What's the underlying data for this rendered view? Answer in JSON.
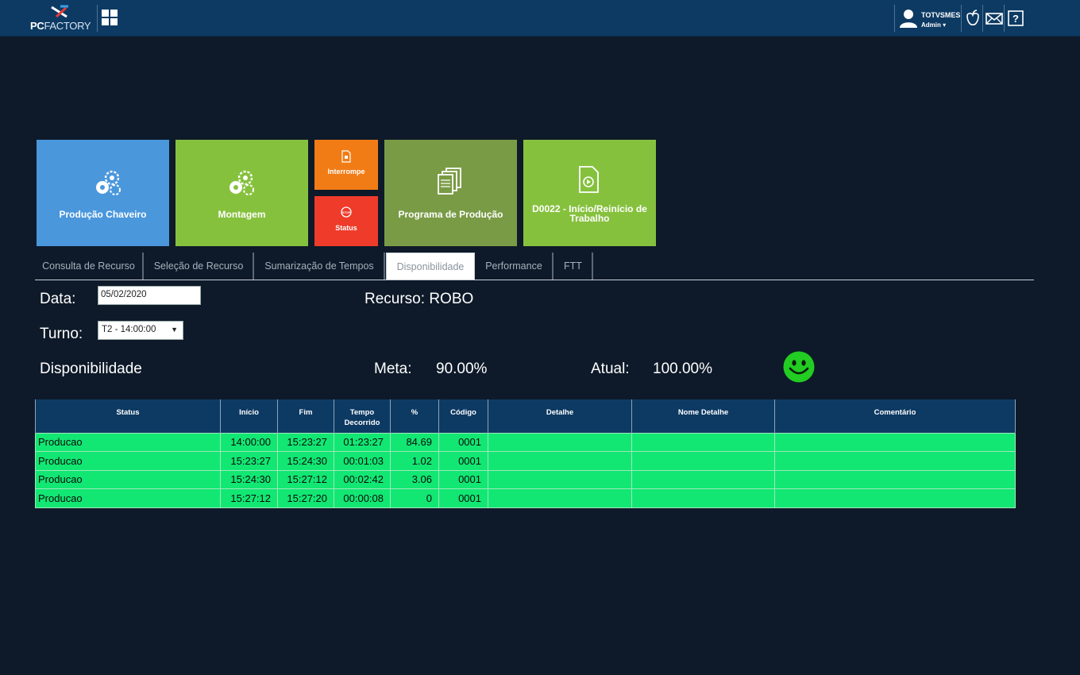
{
  "header": {
    "logo_bold": "PC",
    "logo_rest": "FACTORY",
    "apps_icon": "grid-icon",
    "user": {
      "name": "TOTVSMES",
      "role": "Admin"
    },
    "icons": [
      "apple-icon",
      "mail-icon",
      "help-icon"
    ]
  },
  "tiles": {
    "producao_chaveiro": "Produção Chaveiro",
    "montagem": "Montagem",
    "interrompe": "Interrompe",
    "status": "Status",
    "programa": "Programa de Produção",
    "d0022": "D0022 - Início/Reinício de Trabalho",
    "colors": {
      "blue": "#4a97dc",
      "green": "#86c13e",
      "orange": "#f17c16",
      "red": "#ef3b2a",
      "olive": "#7a9b46"
    }
  },
  "tabs": [
    {
      "label": "Consulta de Recurso"
    },
    {
      "label": "Seleção de Recurso"
    },
    {
      "label": "Sumarização de Tempos"
    },
    {
      "label": "Disponibilidade",
      "active": true
    },
    {
      "label": "Performance"
    },
    {
      "label": "FTT"
    }
  ],
  "form": {
    "data_label": "Data:",
    "data_value": "05/02/2020",
    "turno_label": "Turno:",
    "turno_value": "T2 - 14:00:00",
    "recurso_label": "Recurso:",
    "recurso_value": "ROBO"
  },
  "summary": {
    "title": "Disponibilidade",
    "meta_label": "Meta:",
    "meta_value": "90.00%",
    "atual_label": "Atual:",
    "atual_value": "100.00%",
    "indicator": "smiley-icon",
    "indicator_color": "#22cc22"
  },
  "table": {
    "headers": [
      "Status",
      "Início",
      "Fim",
      "Tempo Decorrido",
      "%",
      "Código",
      "Detalhe",
      "Nome Detalhe",
      "Comentário"
    ],
    "rows": [
      [
        "Producao",
        "14:00:00",
        "15:23:27",
        "01:23:27",
        "84.69",
        "0001",
        "",
        "",
        ""
      ],
      [
        "Producao",
        "15:23:27",
        "15:24:30",
        "00:01:03",
        "1.02",
        "0001",
        "",
        "",
        ""
      ],
      [
        "Producao",
        "15:24:30",
        "15:27:12",
        "00:02:42",
        "3.06",
        "0001",
        "",
        "",
        ""
      ],
      [
        "Producao",
        "15:27:12",
        "15:27:20",
        "00:00:08",
        "0",
        "0001",
        "",
        "",
        ""
      ]
    ],
    "row_color": "#12e773",
    "header_color": "#0d3a63"
  }
}
